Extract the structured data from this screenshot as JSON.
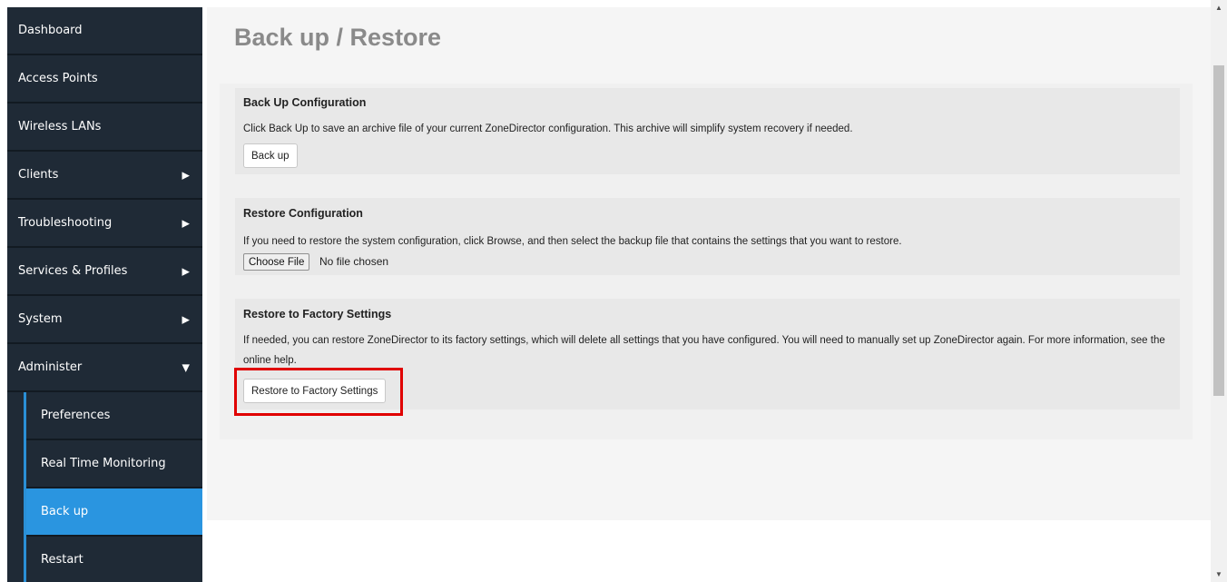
{
  "sidebar": {
    "items": [
      {
        "label": "Dashboard",
        "arrow": ""
      },
      {
        "label": "Access Points",
        "arrow": ""
      },
      {
        "label": "Wireless LANs",
        "arrow": ""
      },
      {
        "label": "Clients",
        "arrow": "▶"
      },
      {
        "label": "Troubleshooting",
        "arrow": "▶"
      },
      {
        "label": "Services & Profiles",
        "arrow": "▶"
      },
      {
        "label": "System",
        "arrow": "▶"
      },
      {
        "label": "Administer",
        "arrow": "▼"
      }
    ],
    "sub_items": [
      {
        "label": "Preferences",
        "active": false
      },
      {
        "label": "Real Time Monitoring",
        "active": false
      },
      {
        "label": "Back up",
        "active": true
      },
      {
        "label": "Restart",
        "active": false
      }
    ]
  },
  "main": {
    "title": "Back up / Restore",
    "backup": {
      "heading": "Back Up Configuration",
      "description": "Click Back Up to save an archive file of your current ZoneDirector configuration. This archive will simplify system recovery if needed.",
      "button": "Back up"
    },
    "restore": {
      "heading": "Restore Configuration",
      "description": "If you need to restore the system configuration, click Browse, and then select the backup file that contains the settings that you want to restore.",
      "file_button": "Choose File",
      "file_status": "No file chosen"
    },
    "factory": {
      "heading": "Restore to Factory Settings",
      "description": "If needed, you can restore ZoneDirector to its factory settings, which will delete all settings that you have configured. You will need to manually set up ZoneDirector again. For more information, see the online help.",
      "button": "Restore to Factory Settings"
    }
  },
  "colors": {
    "sidebar_bg": "#1f2a36",
    "active_bg": "#2a95e0",
    "highlight": "#e00000"
  },
  "icons": {
    "collapsed": "triangle-right-icon",
    "expanded": "triangle-down-icon",
    "scroll_up": "scroll-up-arrow-icon",
    "scroll_down": "scroll-down-arrow-icon"
  }
}
